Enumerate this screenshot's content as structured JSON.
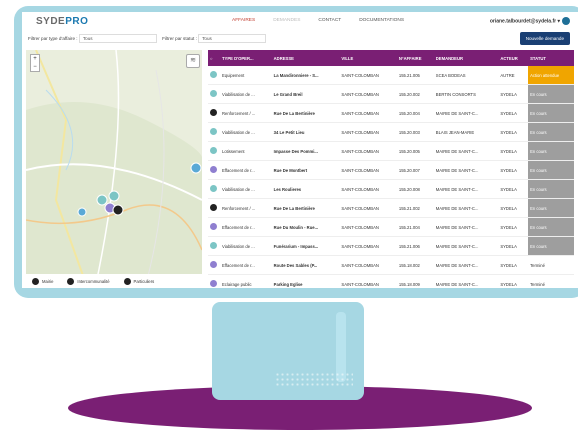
{
  "brand": {
    "logo_main": "SYDE",
    "logo_accent": "PRO"
  },
  "nav": {
    "items": [
      "AFFAIRES",
      "DEMANDES",
      "CONTACT",
      "DOCUMENTATIONS"
    ]
  },
  "user": {
    "email": "oriane.talbourdet@sydela.fr",
    "caret": "▾"
  },
  "filters": {
    "type_label": "Filtrer par type d'affaire :",
    "type_value": "Tous",
    "statut_label": "Filtrer par statut :",
    "statut_value": "Tous"
  },
  "new_request_button": "Nouvelle demande",
  "map": {
    "zoom_in": "+",
    "zoom_out": "−",
    "layers_icon": "layers-icon"
  },
  "legend": {
    "items": [
      "Mairie",
      "Intercommunalité",
      "Particuliers"
    ]
  },
  "table": {
    "headers": [
      "TYPE D'OPER...",
      "ADRESSE",
      "VILLE",
      "N°AFFAIRE",
      "DEMANDEUR",
      "ACTEUR",
      "STATUT"
    ],
    "rows": [
      {
        "icon_color": "#7cc5c5",
        "type": "Equipement",
        "adresse": "La Mandironniere - S...",
        "ville": "SAINT-COLOMBAN",
        "num": "155.21.005",
        "demandeur": "SCEA BODEAS",
        "acteur": "AUTRE",
        "statut": "Action attendue",
        "statut_class": "st-orange"
      },
      {
        "icon_color": "#7cc5c5",
        "type": "Viabilisation de ...",
        "adresse": "Le Grand Breil",
        "ville": "SAINT-COLOMBAN",
        "num": "155.20.002",
        "demandeur": "BERTIN CONSORTS",
        "acteur": "SYDELA",
        "statut": "En cours",
        "statut_class": "st-grey"
      },
      {
        "icon_color": "#222222",
        "type": "Renforcement / ...",
        "adresse": "Rue De La Bertinière",
        "ville": "SAINT-COLOMBAN",
        "num": "155.20.004",
        "demandeur": "MAIRIE DE SAINT-C...",
        "acteur": "SYDELA",
        "statut": "En cours",
        "statut_class": "st-grey"
      },
      {
        "icon_color": "#7cc5c5",
        "type": "Viabilisation de ...",
        "adresse": "34 Le Petit Lieu",
        "ville": "SAINT-COLOMBAN",
        "num": "155.20.003",
        "demandeur": "BLAIS JEAN-MARIE",
        "acteur": "SYDELA",
        "statut": "En cours",
        "statut_class": "st-grey"
      },
      {
        "icon_color": "#7cc5c5",
        "type": "Lotissement",
        "adresse": "Impasse Des Pommi...",
        "ville": "SAINT-COLOMBAN",
        "num": "155.20.005",
        "demandeur": "MAIRIE DE SAINT-C...",
        "acteur": "SYDELA",
        "statut": "En cours",
        "statut_class": "st-grey"
      },
      {
        "icon_color": "#8f7fd0",
        "type": "Effacement de r...",
        "adresse": "Rue De Montbert",
        "ville": "SAINT-COLOMBAN",
        "num": "155.20.007",
        "demandeur": "MAIRIE DE SAINT-C...",
        "acteur": "SYDELA",
        "statut": "En cours",
        "statut_class": "st-grey"
      },
      {
        "icon_color": "#7cc5c5",
        "type": "Viabilisation de ...",
        "adresse": "Les Roulieres",
        "ville": "SAINT-COLOMBAN",
        "num": "155.20.008",
        "demandeur": "MAIRIE DE SAINT-C...",
        "acteur": "SYDELA",
        "statut": "En cours",
        "statut_class": "st-grey"
      },
      {
        "icon_color": "#222222",
        "type": "Renforcement / ...",
        "adresse": "Rue De La Bertinière",
        "ville": "SAINT-COLOMBAN",
        "num": "155.21.002",
        "demandeur": "MAIRIE DE SAINT-C...",
        "acteur": "SYDELA",
        "statut": "En cours",
        "statut_class": "st-grey"
      },
      {
        "icon_color": "#8f7fd0",
        "type": "Effacement de r...",
        "adresse": "Rue Du Moulin - Rue...",
        "ville": "SAINT-COLOMBAN",
        "num": "155.21.004",
        "demandeur": "MAIRIE DE SAINT-C...",
        "acteur": "SYDELA",
        "statut": "En cours",
        "statut_class": "st-grey"
      },
      {
        "icon_color": "#7cc5c5",
        "type": "Viabilisation de ...",
        "adresse": "Funérarium - Impass...",
        "ville": "SAINT-COLOMBAN",
        "num": "155.21.006",
        "demandeur": "MAIRIE DE SAINT-C...",
        "acteur": "SYDELA",
        "statut": "En cours",
        "statut_class": "st-grey"
      },
      {
        "icon_color": "#8f7fd0",
        "type": "Effacement de r...",
        "adresse": "Route Des Sables (P...",
        "ville": "SAINT-COLOMBAN",
        "num": "155.18.002",
        "demandeur": "MAIRIE DE SAINT-C...",
        "acteur": "SYDELA",
        "statut": "Terminé",
        "statut_class": "st-white"
      },
      {
        "icon_color": "#8f7fd0",
        "type": "Eclairage public",
        "adresse": "Parking Eglise",
        "ville": "SAINT-COLOMBAN",
        "num": "155.18.009",
        "demandeur": "MAIRIE DE SAINT-C...",
        "acteur": "SYDELA",
        "statut": "Terminé",
        "statut_class": "st-white"
      }
    ]
  }
}
